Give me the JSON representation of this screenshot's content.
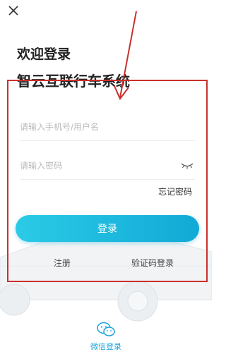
{
  "header": {
    "close_icon": "close-icon",
    "welcome_text": "欢迎登录",
    "system_name": "智云互联行车系统"
  },
  "form": {
    "username_placeholder": "请输入手机号/用户名",
    "username_value": "",
    "password_placeholder": "请输入密码",
    "password_value": "",
    "password_toggle_icon": "eye-closed-icon",
    "forgot_password": "忘记密码",
    "login_button": "登录"
  },
  "links": {
    "register": "注册",
    "sms_login": "验证码登录"
  },
  "third_party": {
    "wechat_icon": "wechat-icon",
    "wechat_label": "微信登录"
  },
  "colors": {
    "accent": "#1ca5d8",
    "button_gradient_start": "#2bcbe6",
    "button_gradient_end": "#11a9d6",
    "annotation": "#c9302c"
  }
}
